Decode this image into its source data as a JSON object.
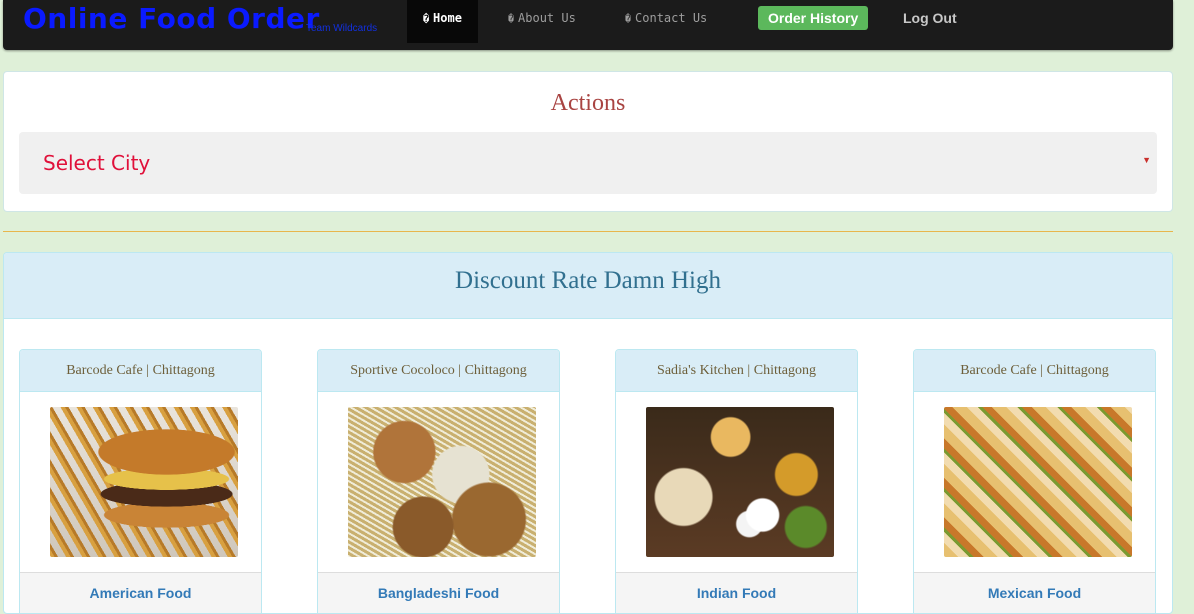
{
  "navbar": {
    "brand": "Online Food Order",
    "brand_sub": "Team Wildcards",
    "items": [
      {
        "icon": "home-icon",
        "label": "Home",
        "active": true
      },
      {
        "icon": "info-icon",
        "label": "About Us",
        "active": false
      },
      {
        "icon": "contact-icon",
        "label": "Contact Us",
        "active": false
      }
    ],
    "order_history": "Order History",
    "logout": "Log Out",
    "icon_glyph": "�"
  },
  "actions": {
    "title": "Actions",
    "select_city": "Select City"
  },
  "discount": {
    "title": "Discount Rate Damn High",
    "cards": [
      {
        "place": "Barcode Cafe | Chittagong",
        "image": "burger-fries",
        "label": "American Food"
      },
      {
        "place": "Sportive Cocoloco | Chittagong",
        "image": "bangladeshi-snacks",
        "label": "Bangladeshi Food"
      },
      {
        "place": "Sadia's Kitchen | Chittagong",
        "image": "indian-thali",
        "label": "Indian Food"
      },
      {
        "place": "Barcode Cafe | Chittagong",
        "image": "tacos",
        "label": "Mexican Food"
      }
    ]
  },
  "colors": {
    "brand": "#0a1aff",
    "order_history_bg": "#5cb85c",
    "actions_title": "#a94442",
    "select_city_text": "#e0103a",
    "discount_title": "#31708f",
    "link": "#337ab7"
  }
}
